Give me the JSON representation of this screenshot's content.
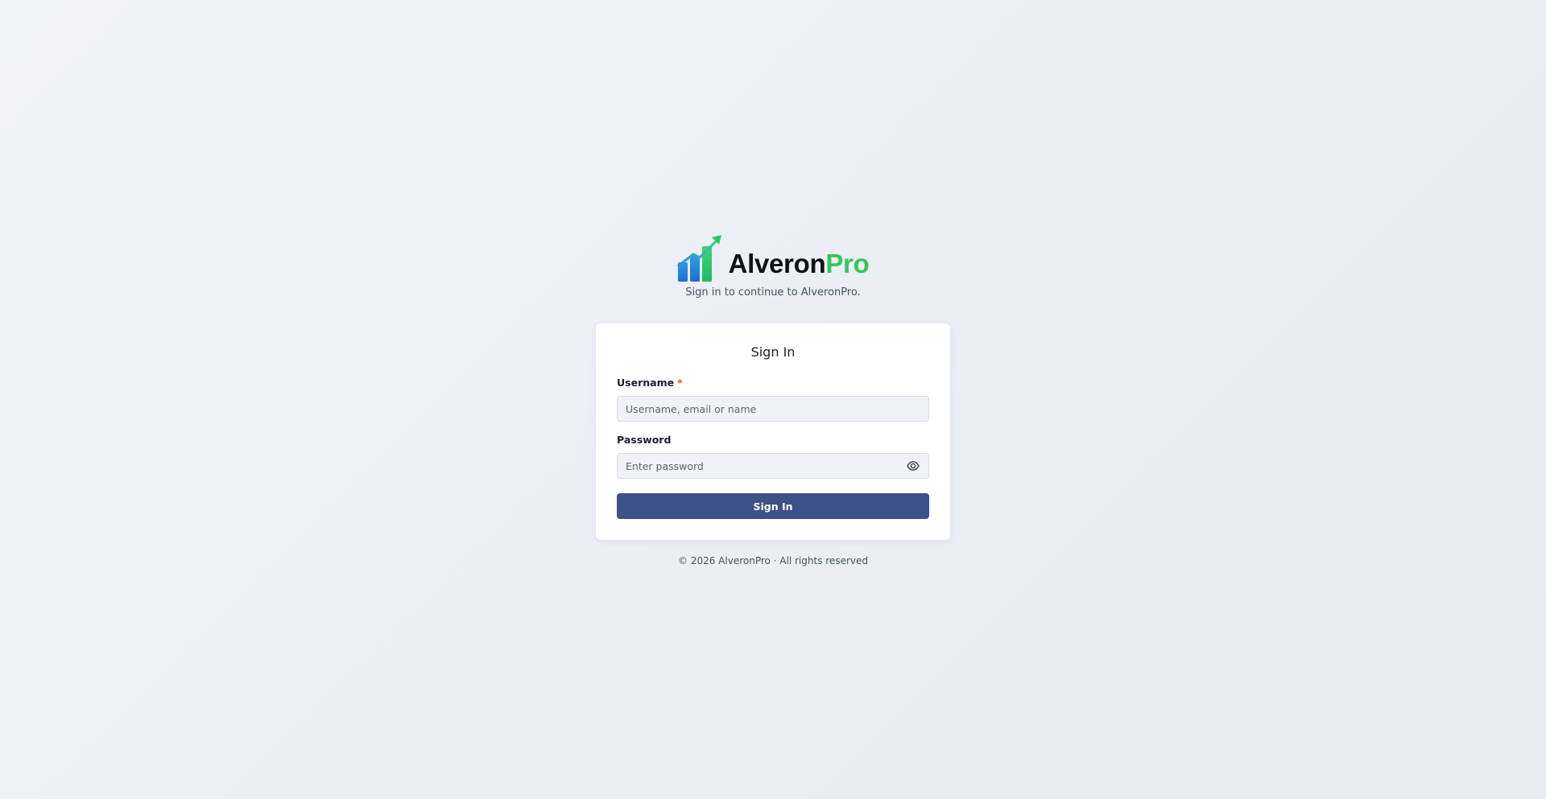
{
  "brand": {
    "name_part1": "Alveron",
    "name_part2": "Pro",
    "logo_icon": "bar-chart-growth-icon",
    "accent_color": "#34c759",
    "bar_color": "#2d8fe0"
  },
  "subtitle": "Sign in to continue to AlveronPro.",
  "form": {
    "title": "Sign In",
    "username": {
      "label": "Username",
      "required_mark": "*",
      "placeholder": "Username, email or name",
      "value": ""
    },
    "password": {
      "label": "Password",
      "placeholder": "Enter password",
      "value": "",
      "toggle_icon": "eye-icon"
    },
    "submit_label": "Sign In",
    "button_color": "#3e5088"
  },
  "footer": "© 2026 AlveronPro · All rights reserved"
}
